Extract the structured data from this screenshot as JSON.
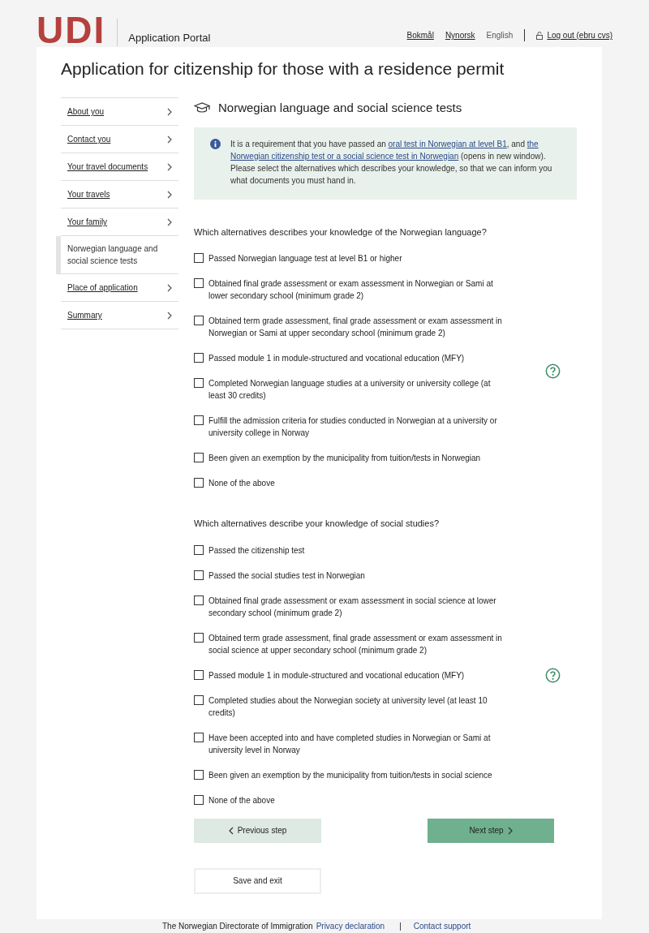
{
  "header": {
    "logo": "UDI",
    "portal": "Application Portal",
    "languages": [
      {
        "label": "Bokmål",
        "selected": false
      },
      {
        "label": "Nynorsk",
        "selected": false
      },
      {
        "label": "English",
        "selected": true
      }
    ],
    "logout": "Log out (ebru cvs)"
  },
  "title": "Application for citizenship for those with a residence permit",
  "sidebar": {
    "items": [
      {
        "label": "About you",
        "selected": false
      },
      {
        "label": "Contact you",
        "selected": false
      },
      {
        "label": "Your travel documents",
        "selected": false
      },
      {
        "label": "Your travels",
        "selected": false
      },
      {
        "label": "Your family",
        "selected": false
      },
      {
        "label": "Norwegian language and social science tests",
        "selected": true
      },
      {
        "label": "Place of application",
        "selected": false
      },
      {
        "label": "Summary",
        "selected": false
      }
    ]
  },
  "section_title": "Norwegian language and social science tests",
  "info": {
    "parts": [
      {
        "kind": "text",
        "text": "It is a requirement that you have passed an "
      },
      {
        "kind": "link",
        "text": "oral test in Norwegian at level B1"
      },
      {
        "kind": "text",
        "text": ", and "
      },
      {
        "kind": "link",
        "text": "the"
      },
      {
        "kind": "link",
        "text": "Norwegian citizenship test or a social science test in Norwegian"
      },
      {
        "kind": "text",
        "text": " (opens in new window). Please select the alternatives which describes your knowledge, so that we can inform you what documents you must hand in."
      }
    ]
  },
  "groups": [
    {
      "question": "Which alternatives describes your knowledge of the Norwegian language?",
      "options": [
        {
          "label": "Passed Norwegian language test at level B1 or higher",
          "checked": false
        },
        {
          "label": "Obtained final grade assessment or exam assessment in Norwegian or Sami at lower secondary school (minimum grade 2)",
          "checked": false
        },
        {
          "label": "Obtained term grade assessment, final grade assessment or exam assessment in Norwegian or Sami at upper secondary school (minimum grade 2)",
          "checked": false
        },
        {
          "label": "Passed module 1 in module-structured and vocational education (MFY)",
          "checked": false
        },
        {
          "label": "Completed Norwegian language studies at a university or university college (at least 30 credits)",
          "checked": false
        },
        {
          "label": "Fulfill the admission criteria for studies conducted in Norwegian at a university or university college in Norway",
          "checked": false
        },
        {
          "label": "Been given an exemption by the municipality from tuition/tests in Norwegian",
          "checked": false
        },
        {
          "label": "None of the above",
          "checked": false
        }
      ]
    },
    {
      "question": "Which alternatives describe your knowledge of social studies?",
      "options": [
        {
          "label": "Passed the citizenship test",
          "checked": false
        },
        {
          "label": "Passed the social studies test in Norwegian",
          "checked": false
        },
        {
          "label": "Obtained final grade assessment or exam assessment in social science at lower secondary school (minimum grade 2)",
          "checked": false
        },
        {
          "label": "Obtained term grade assessment, final grade assessment or exam assessment in social science at upper secondary school (minimum grade 2)",
          "checked": false
        },
        {
          "label": "Passed module 1 in module-structured and vocational education (MFY)",
          "checked": false
        },
        {
          "label": "Completed studies about the Norwegian society at university level (at least 10 credits)",
          "checked": false
        },
        {
          "label": "Have been accepted into and have completed studies in Norwegian or Sami at university level in Norway",
          "checked": false
        },
        {
          "label": "Been given an exemption by the municipality from tuition/tests in social science",
          "checked": false
        },
        {
          "label": "None of the above",
          "checked": false
        }
      ]
    }
  ],
  "buttons": {
    "previous": "Previous step",
    "next": "Next step",
    "save": "Save and exit"
  },
  "footer": {
    "org": "The Norwegian Directorate of Immigration",
    "privacy": "Privacy declaration",
    "separator": "|",
    "support": "Contact support"
  }
}
